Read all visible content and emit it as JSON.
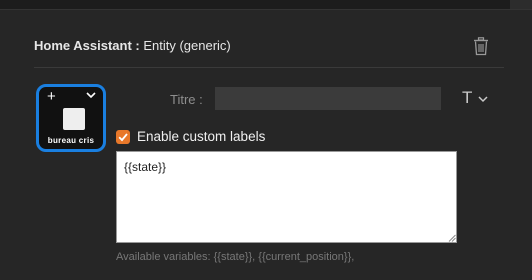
{
  "header": {
    "integration": "Home Assistant",
    "separator": " : ",
    "action": "Entity (generic)"
  },
  "key": {
    "add_symbol": "+",
    "label": "bureau cris"
  },
  "title_field": {
    "label": "Titre :",
    "value": "",
    "font_button": "T"
  },
  "custom_labels": {
    "checked": true,
    "label": "Enable custom labels",
    "value": "{{state}}"
  },
  "help_text": "Available variables: {{state}}, {{current_position}},",
  "colors": {
    "accent_blue": "#1a7fe0",
    "checkbox_orange": "#e8782a",
    "background": "#262626"
  },
  "icons": [
    "trash-icon",
    "plus-icon",
    "chevron-down-icon",
    "font-icon",
    "checkmark-icon"
  ]
}
